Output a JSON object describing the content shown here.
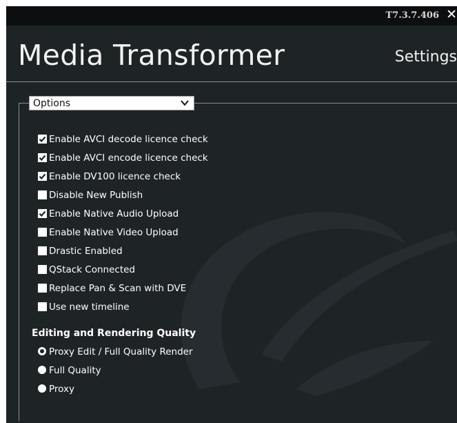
{
  "app": {
    "version": "T7.3.7.406",
    "title": "Media Transformer",
    "section": "Settings"
  },
  "options_dropdown": {
    "selected": "Options"
  },
  "checkbox_options": [
    {
      "label": "Enable AVCI decode licence check",
      "checked": true
    },
    {
      "label": "Enable AVCI encode licence check",
      "checked": true
    },
    {
      "label": "Enable DV100 licence check",
      "checked": true
    },
    {
      "label": "Disable New Publish",
      "checked": false
    },
    {
      "label": "Enable Native Audio Upload",
      "checked": true
    },
    {
      "label": "Enable Native Video Upload",
      "checked": false
    },
    {
      "label": "Drastic Enabled",
      "checked": false
    },
    {
      "label": "QStack Connected",
      "checked": false
    },
    {
      "label": "Replace Pan & Scan with DVE",
      "checked": false
    },
    {
      "label": "Use new timeline",
      "checked": false
    }
  ],
  "quality": {
    "heading": "Editing and Rendering Quality",
    "options": [
      {
        "label": "Proxy Edit / Full Quality Render",
        "selected": true
      },
      {
        "label": "Full Quality",
        "selected": false
      },
      {
        "label": "Proxy",
        "selected": false
      }
    ]
  },
  "icons": {
    "close": "close-icon",
    "dropdown": "chevron-down-icon",
    "watermark": "gv-logo-watermark"
  },
  "colors": {
    "window_bg": "#1e2326",
    "topbar_bg": "#0d0e10",
    "text": "#ffffff",
    "rule": "#8a8f93"
  }
}
